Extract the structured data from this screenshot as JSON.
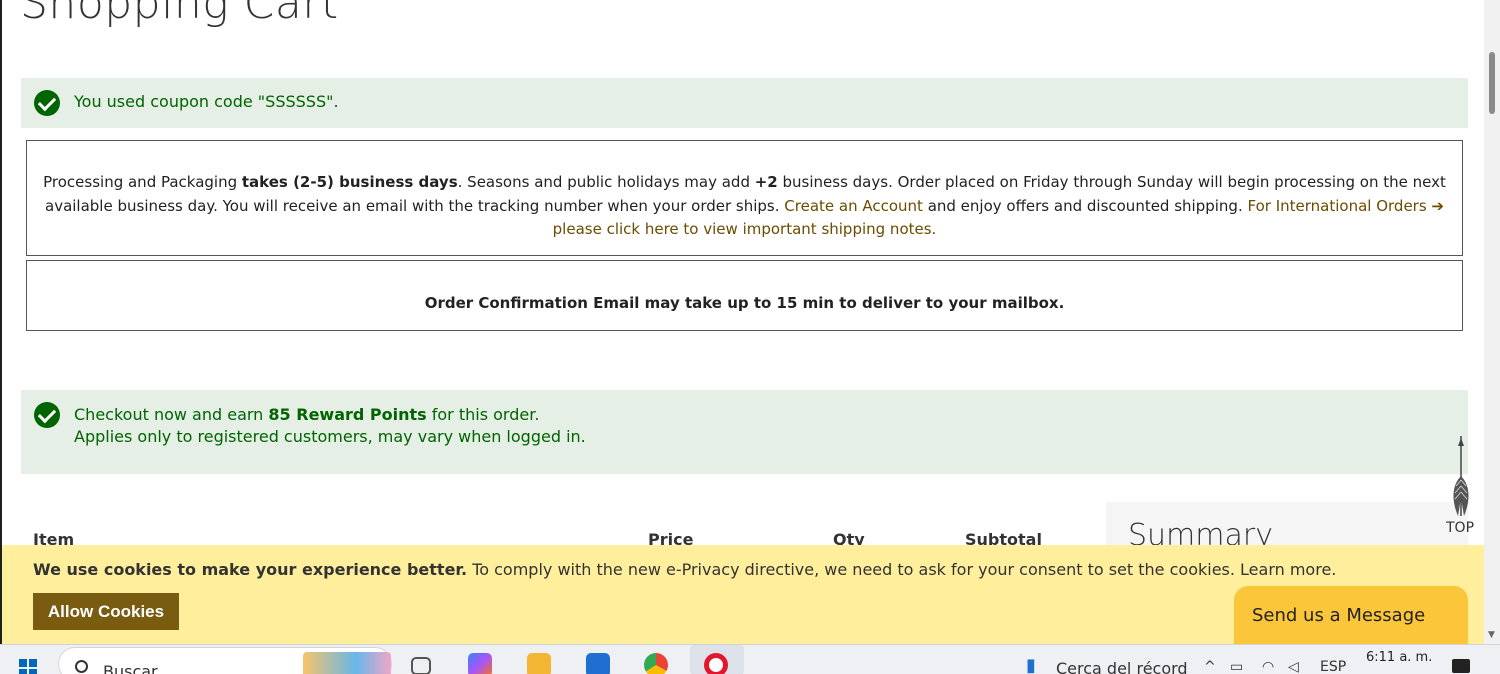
{
  "page": {
    "title": "Shopping Cart"
  },
  "messages": {
    "coupon": "You used coupon code \"SSSSSS\".",
    "reward_prefix": "Checkout now and earn ",
    "reward_points": "85 Reward Points",
    "reward_suffix": " for this order.",
    "reward_line2": "Applies only to registered customers, may vary when logged in."
  },
  "notice": {
    "p1": "Processing and Packaging ",
    "p1_bold": "takes (2-5) business days",
    "p2": ". Seasons and public holidays may add ",
    "p2_bold": "+2",
    "p3": " business days. Order placed on Friday through Sunday will begin processing on the next available business day. You will receive an email with the tracking number when your order ships.  ",
    "create_account_link": "Create an Account",
    "p4": " and enjoy offers and discounted shipping. ",
    "international_link": "For International Orders ➔ please click here to view important shipping notes.",
    "confirmation": "Order Confirmation Email may take up to 15 min to deliver to your mailbox."
  },
  "cart_table": {
    "columns": [
      "Item",
      "Price",
      "Qty",
      "Subtotal"
    ]
  },
  "summary": {
    "title": "Summary"
  },
  "top_button": {
    "label": "TOP"
  },
  "cookies": {
    "bold": "We use cookies to make your experience better.",
    "text": " To comply with the new e-Privacy directive, we need to ask for your consent to set the cookies. Learn more.",
    "allow_label": "Allow Cookies"
  },
  "chat": {
    "label": "Send us a Message"
  },
  "taskbar": {
    "search_placeholder": "Buscar",
    "weather": "Cerca del récord",
    "language": "ESP",
    "time": "6:11 a. m."
  },
  "colors": {
    "success_bg": "#e5efe5",
    "success_text": "#006400",
    "cookie_bg": "#ffee9c",
    "allow_btn": "#7a5c11",
    "chat_btn": "#fcc63b",
    "link": "#6b4c00"
  }
}
